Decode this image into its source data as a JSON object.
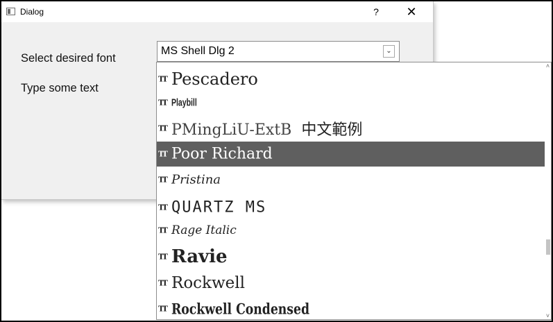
{
  "window": {
    "title": "Dialog",
    "help_label": "?",
    "close_label": "✕"
  },
  "labels": {
    "select_font": "Select desired font",
    "type_text": "Type some text"
  },
  "combo": {
    "value": "MS Shell Dlg 2",
    "arrow": "⌄"
  },
  "font_list": {
    "items": [
      {
        "label": "Pescadero"
      },
      {
        "label": "Playbill"
      },
      {
        "label": "PMingLiU-ExtB",
        "sample": "中文範例"
      },
      {
        "label": "Poor Richard",
        "selected": true
      },
      {
        "label": "Pristina"
      },
      {
        "label": "QUARTZ MS"
      },
      {
        "label": "Rage Italic"
      },
      {
        "label": "Ravie"
      },
      {
        "label": "Rockwell"
      },
      {
        "label": "Rockwell Condensed"
      }
    ],
    "tt_glyph": "TT"
  },
  "scrollbar": {
    "up": "˄",
    "down": "˅"
  }
}
